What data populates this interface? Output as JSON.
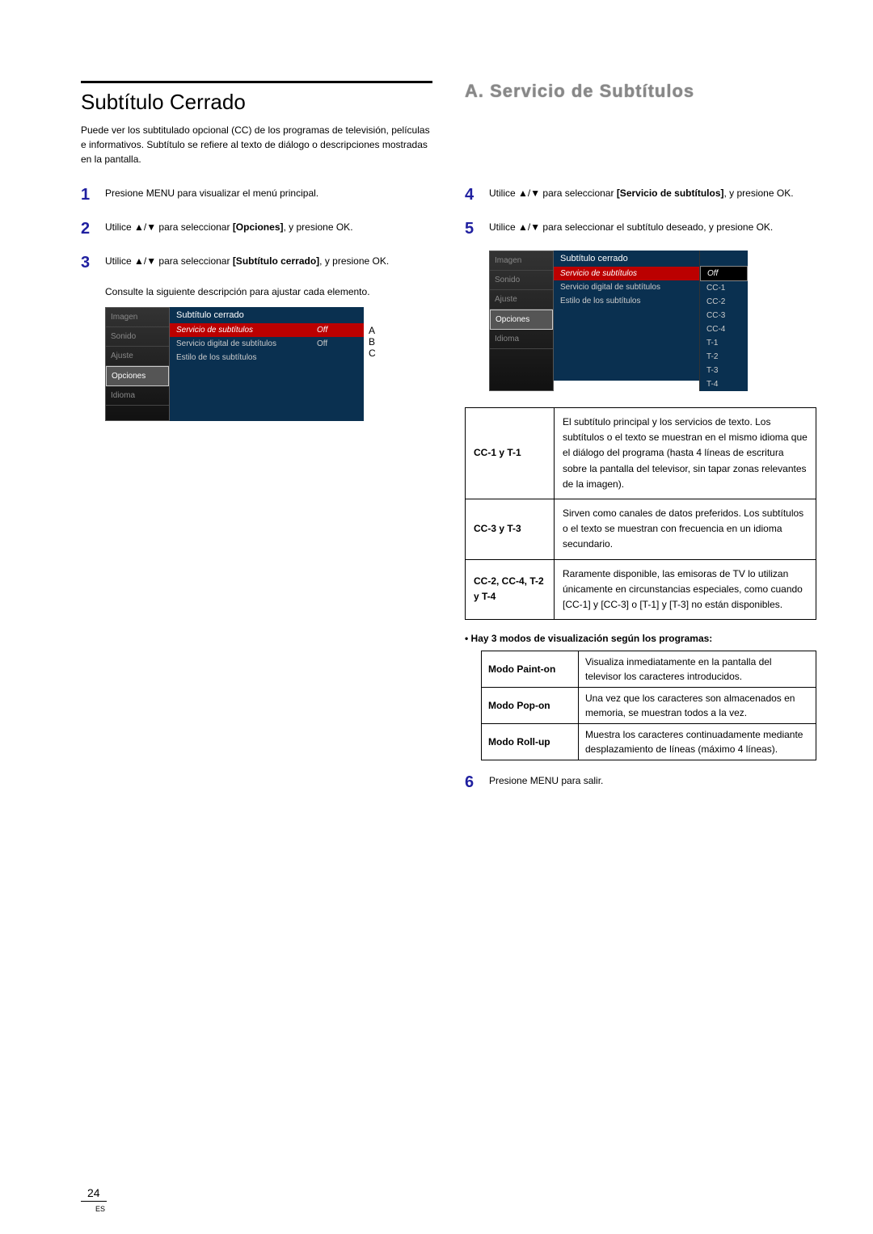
{
  "section_title": "Subtítulo Cerrado",
  "intro": "Puede ver los subtitulado opcional (CC) de los programas de televisión, películas e informativos. Subtítulo se refiere al texto de diálogo o descripciones mostradas en la pantalla.",
  "steps_left": {
    "s1": "Presione MENU para visualizar el menú principal.",
    "s2_a": "Utilice ▲/▼ para seleccionar ",
    "s2_b": "[Opciones]",
    "s2_c": ", y presione OK.",
    "s3_a": "Utilice ▲/▼ para seleccionar ",
    "s3_b": "[Subtítulo cerrado]",
    "s3_c": ", y presione OK.",
    "s3_sub": "Consulte la siguiente descripción para ajustar cada elemento."
  },
  "menu_left": {
    "header": "Subtítulo cerrado",
    "sidebar": [
      "Imagen",
      "Sonido",
      "Ajuste",
      "Opciones",
      "Idioma"
    ],
    "rows": [
      {
        "label": "Servicio de subtítulos",
        "val": "Off"
      },
      {
        "label": "Servicio digital de subtítulos",
        "val": "Off"
      },
      {
        "label": "Estilo de los subtítulos",
        "val": ""
      }
    ],
    "abc": [
      "A",
      "B",
      "C"
    ]
  },
  "heading_right": "A. Servicio de Subtítulos",
  "steps_right": {
    "s4_a": "Utilice ▲/▼ para seleccionar ",
    "s4_b": "[Servicio de subtítulos]",
    "s4_c": ", y presione OK.",
    "s5_a": "Utilice ▲/▼ para seleccionar el subtítulo deseado, y presione OK."
  },
  "menu_right": {
    "header": "Subtítulo cerrado",
    "sidebar": [
      "Imagen",
      "Sonido",
      "Ajuste",
      "Opciones",
      "Idioma"
    ],
    "rows": [
      {
        "label": "Servicio de subtítulos"
      },
      {
        "label": "Servicio digital de subtítulos"
      },
      {
        "label": "Estilo de los subtítulos"
      }
    ],
    "values": [
      "Off",
      "CC-1",
      "CC-2",
      "CC-3",
      "CC-4",
      "T-1",
      "T-2",
      "T-3",
      "T-4"
    ]
  },
  "cc_table": [
    {
      "head": "CC-1 y T-1",
      "body": "El subtítulo principal y los servicios de texto.\nLos subtítulos o el texto se muestran en el mismo idioma que el diálogo del programa (hasta 4 líneas de escritura sobre la pantalla del televisor, sin tapar zonas relevantes de la imagen)."
    },
    {
      "head": "CC-3 y T-3",
      "body": "Sirven como canales de datos preferidos. Los subtítulos o el texto se muestran con frecuencia en un idioma secundario."
    },
    {
      "head": "CC-2, CC-4, T-2 y T-4",
      "body": "Raramente disponible, las emisoras de TV lo utilizan únicamente en circunstancias especiales, como cuando [CC-1] y [CC-3] o [T-1] y [T-3] no están disponibles."
    }
  ],
  "bullet": "• Hay 3 modos de visualización según los programas:",
  "mode_table": [
    {
      "head": "Modo Paint-on",
      "body": "Visualiza inmediatamente en la pantalla del televisor los caracteres introducidos."
    },
    {
      "head": "Modo Pop-on",
      "body": "Una vez que los caracteres son almacenados en memoria, se muestran todos a la vez."
    },
    {
      "head": "Modo Roll-up",
      "body": "Muestra los caracteres continuadamente mediante desplazamiento de líneas (máximo 4 líneas)."
    }
  ],
  "step6": "Presione MENU para salir.",
  "page_num": "24",
  "page_es": "ES"
}
